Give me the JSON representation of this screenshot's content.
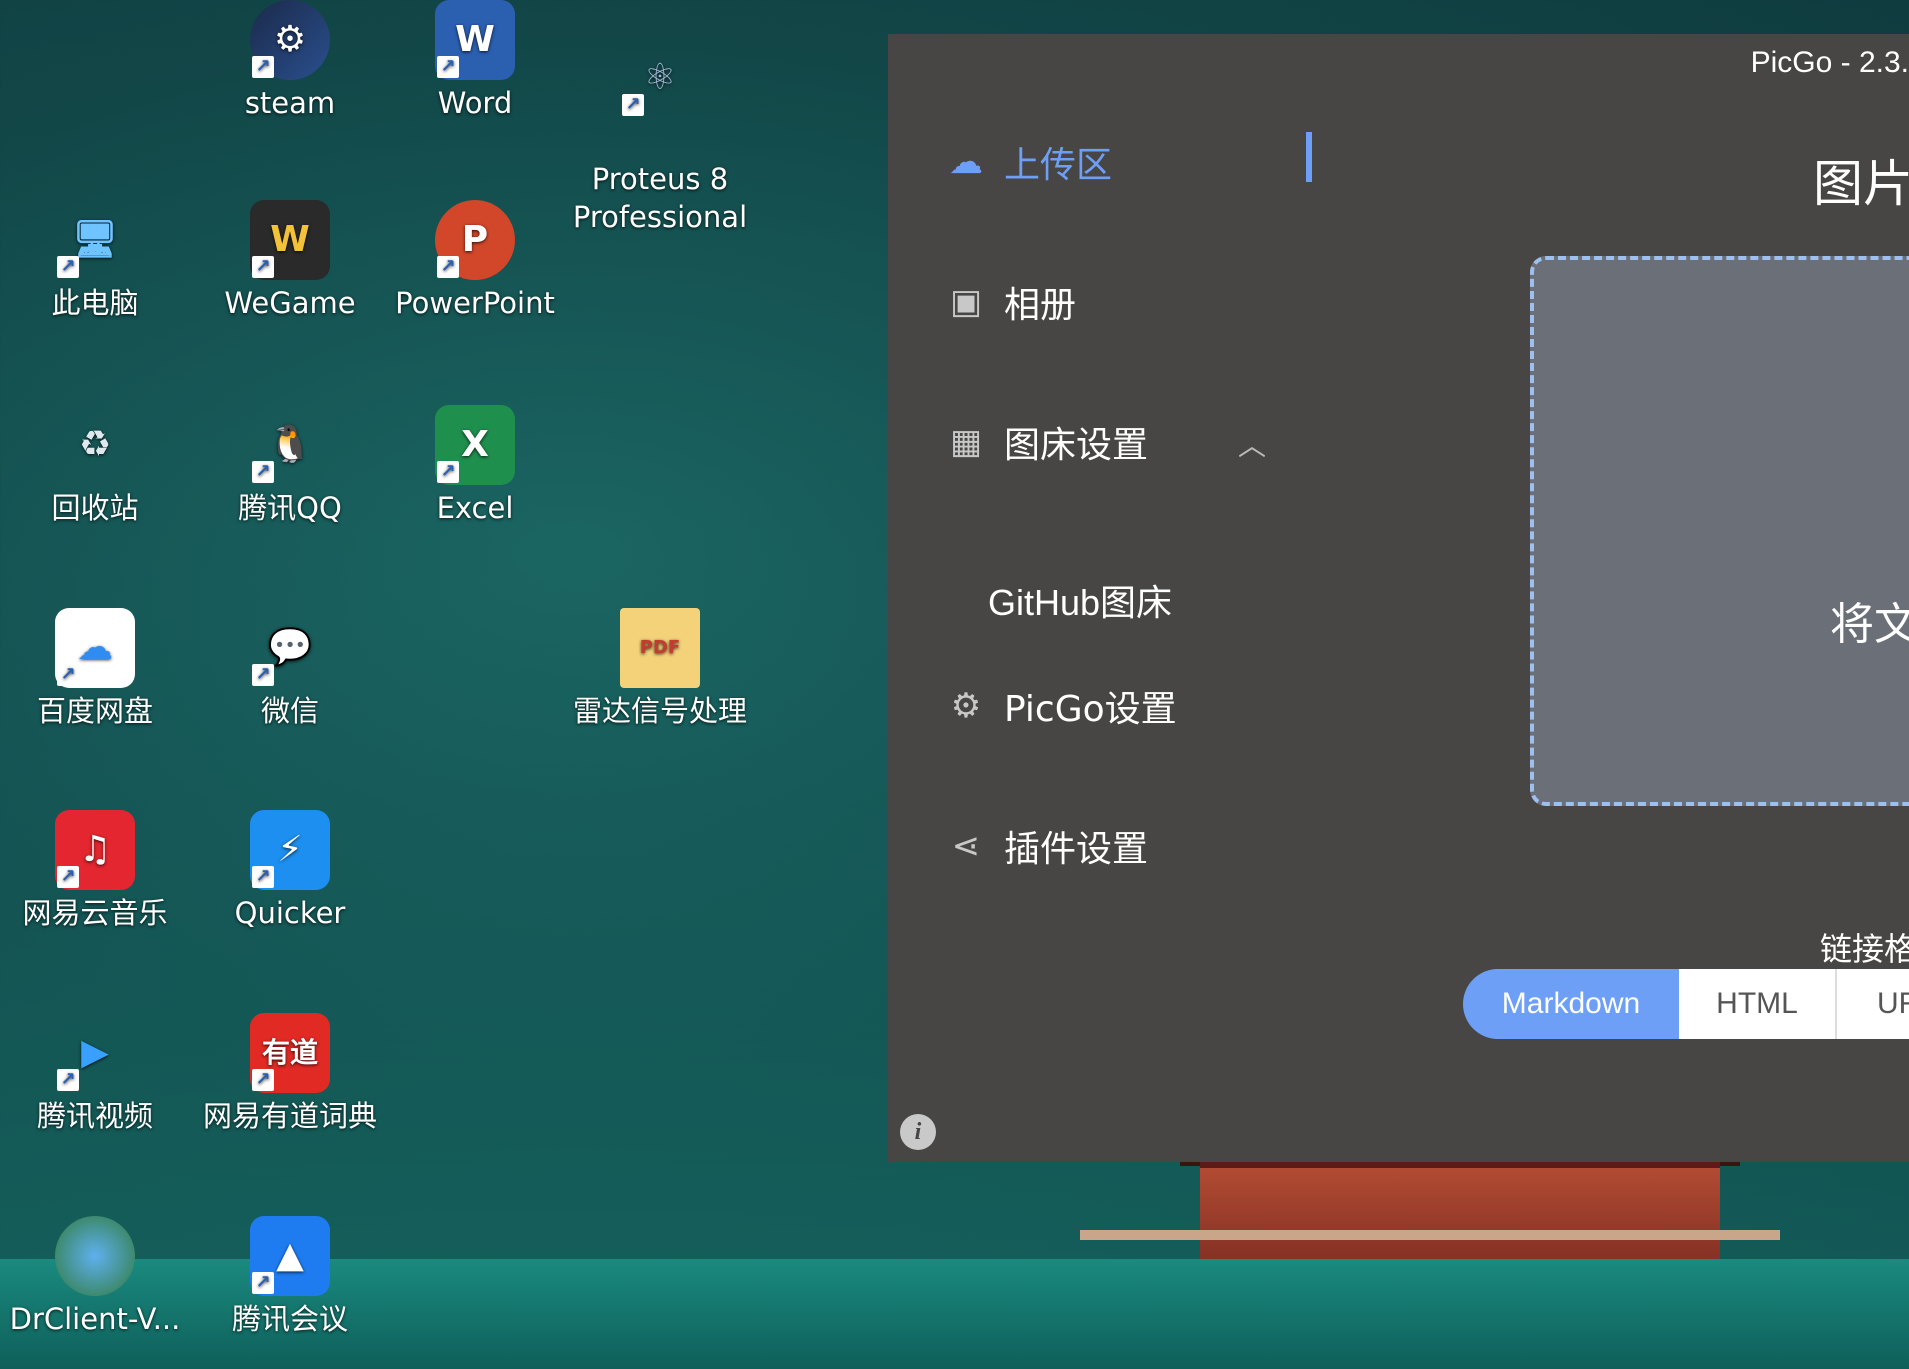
{
  "desktop": {
    "icons": [
      {
        "label": "steam"
      },
      {
        "label": "Word"
      },
      {
        "label": "Proteus 8\nProfessional"
      },
      {
        "label": "此电脑"
      },
      {
        "label": "WeGame"
      },
      {
        "label": "PowerPoint"
      },
      {
        "label": "回收站"
      },
      {
        "label": "腾讯QQ"
      },
      {
        "label": "Excel"
      },
      {
        "label": "百度网盘"
      },
      {
        "label": "微信"
      },
      {
        "label": "雷达信号处理"
      },
      {
        "label": "网易云音乐"
      },
      {
        "label": "Quicker"
      },
      {
        "label": "腾讯视频"
      },
      {
        "label": "网易有道词典"
      },
      {
        "label": "DrClient-V..."
      },
      {
        "label": "腾讯会议"
      }
    ]
  },
  "window": {
    "title": "PicGo - 2.3.",
    "sidebar": {
      "upload": "上传区",
      "gallery": "相册",
      "picbed_settings": "图床设置",
      "github_picbed": "GitHub图床",
      "picgo_settings": "PicGo设置",
      "plugin_settings": "插件设置"
    },
    "main": {
      "heading": "图片",
      "drop_text": "将文",
      "link_format_label": "链接格",
      "formats": {
        "markdown": "Markdown",
        "html": "HTML",
        "url": "UR"
      }
    }
  }
}
